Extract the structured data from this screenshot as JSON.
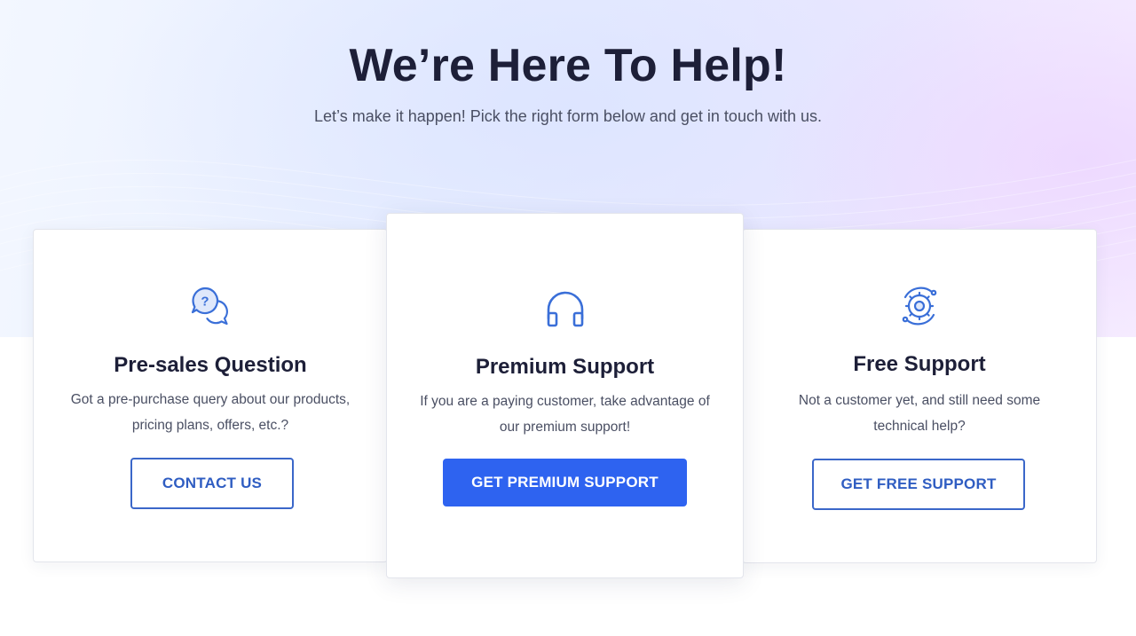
{
  "header": {
    "title": "We’re Here To Help!",
    "subtitle": "Let’s make it happen! Pick the right form below and get in touch with us."
  },
  "cards": [
    {
      "icon": "question-chat-icon",
      "title": "Pre-sales Question",
      "description": "Got a pre-purchase query about our products, pricing plans, offers, etc.?",
      "button_label": "CONTACT US"
    },
    {
      "icon": "headphones-icon",
      "title": "Premium Support",
      "description": "If you are a paying customer, take advantage of our premium support!",
      "button_label": "GET PREMIUM SUPPORT"
    },
    {
      "icon": "gear-support-icon",
      "title": "Free Support",
      "description": "Not a customer yet, and still need some technical help?",
      "button_label": "GET FREE SUPPORT"
    }
  ],
  "colors": {
    "accent": "#2e63f0",
    "outline": "#3b67c9",
    "icon": "#3a6fd8",
    "heading": "#1d1f38"
  }
}
